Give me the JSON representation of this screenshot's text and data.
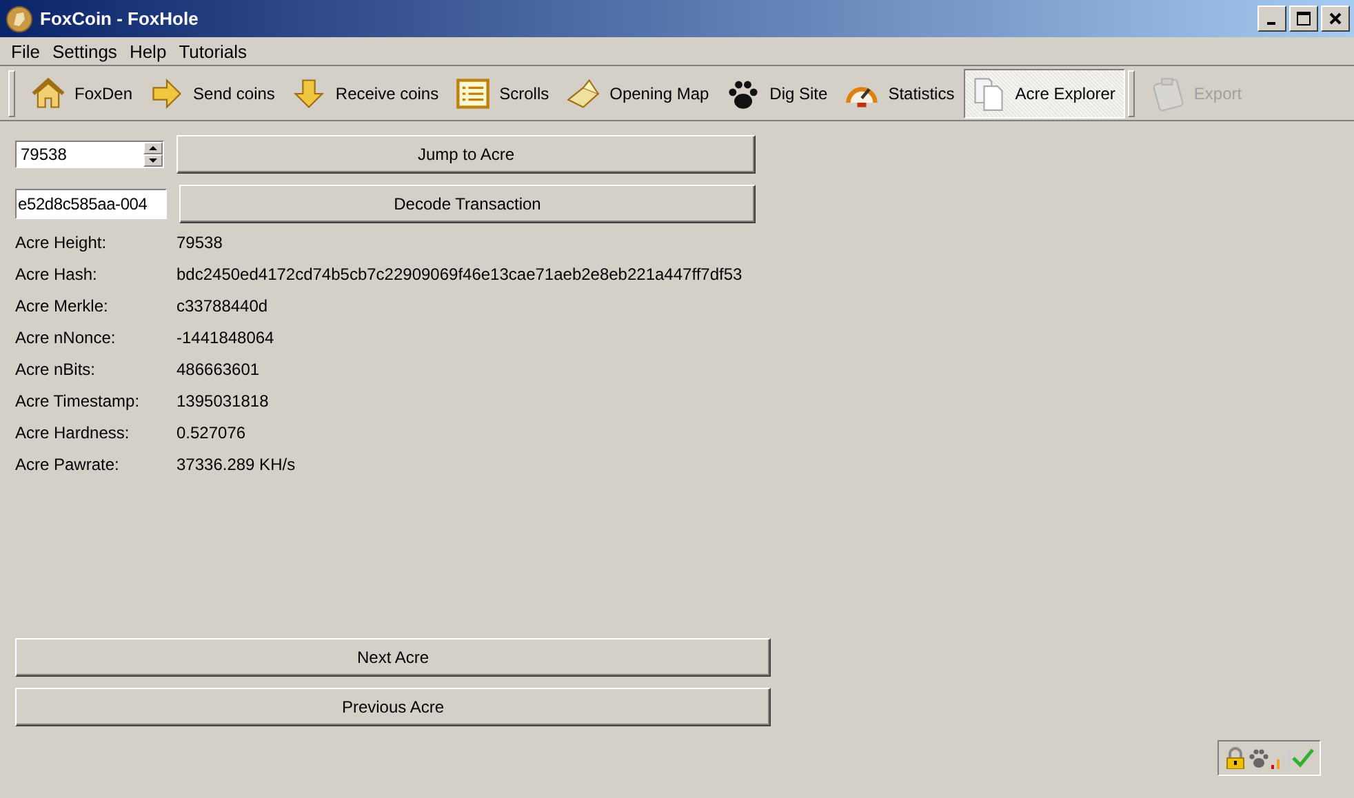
{
  "window": {
    "title": "FoxCoin - FoxHole"
  },
  "menu": [
    "File",
    "Settings",
    "Help",
    "Tutorials"
  ],
  "toolbar": [
    {
      "label": "FoxDen",
      "selected": false,
      "disabled": false
    },
    {
      "label": "Send coins",
      "selected": false,
      "disabled": false
    },
    {
      "label": "Receive coins",
      "selected": false,
      "disabled": false
    },
    {
      "label": "Scrolls",
      "selected": false,
      "disabled": false
    },
    {
      "label": "Opening Map",
      "selected": false,
      "disabled": false
    },
    {
      "label": "Dig Site",
      "selected": false,
      "disabled": false
    },
    {
      "label": "Statistics",
      "selected": false,
      "disabled": false
    },
    {
      "label": "Acre Explorer",
      "selected": true,
      "disabled": false
    },
    {
      "label": "Export",
      "selected": false,
      "disabled": true
    }
  ],
  "acre_input": {
    "value": "79538"
  },
  "jump_button": "Jump to Acre",
  "transaction_input": {
    "value": "e52d8c585aa-004"
  },
  "decode_button": "Decode Transaction",
  "fields": [
    {
      "label": "Acre Height:",
      "value": "79538"
    },
    {
      "label": "Acre Hash:",
      "value": "bdc2450ed4172cd74b5cb7c22909069f46e13cae71aeb2e8eb221a447ff7df53"
    },
    {
      "label": "Acre Merkle:",
      "value": "c33788440d"
    },
    {
      "label": "Acre nNonce:",
      "value": "-1441848064"
    },
    {
      "label": "Acre nBits:",
      "value": "486663601"
    },
    {
      "label": "Acre Timestamp:",
      "value": "1395031818"
    },
    {
      "label": "Acre Hardness:",
      "value": "0.527076"
    },
    {
      "label": "Acre Pawrate:",
      "value": "37336.289 KH/s"
    }
  ],
  "next_button": "Next Acre",
  "previous_button": "Previous Acre"
}
